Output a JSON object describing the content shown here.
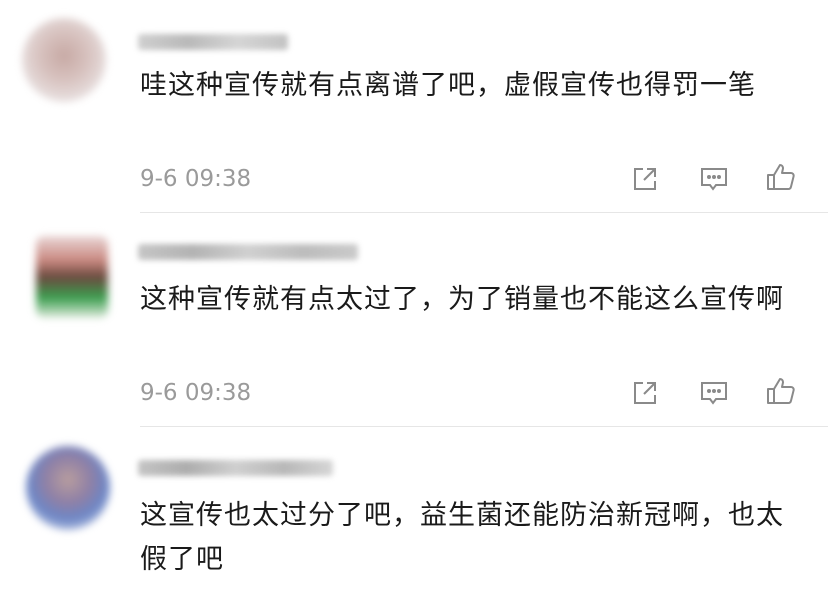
{
  "comments": [
    {
      "text": "哇这种宣传就有点离谱了吧，虚假宣传也得罚一笔",
      "time": "9-6 09:38",
      "icons": {
        "share": "share-icon",
        "reply": "comment-icon",
        "like": "thumbs-up-icon"
      }
    },
    {
      "text": "这种宣传就有点太过了，为了销量也不能这么宣传啊",
      "time": "9-6 09:38",
      "icons": {
        "share": "share-icon",
        "reply": "comment-icon",
        "like": "thumbs-up-icon"
      }
    },
    {
      "text": "这宣传也太过分了吧，益生菌还能防治新冠啊，也太假了吧"
    }
  ],
  "colors": {
    "text": "#1a1a1a",
    "timestamp": "#9a9a9a",
    "icon": "#8a8a8a",
    "divider": "#e6e6e6"
  }
}
